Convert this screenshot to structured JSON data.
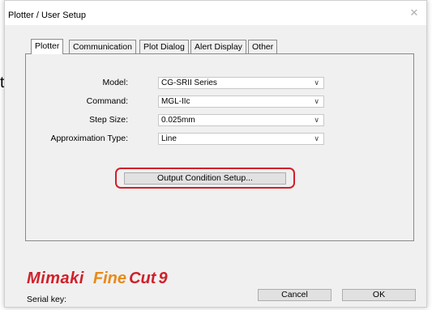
{
  "background": {
    "fragment_text": "t"
  },
  "window": {
    "title": "Plotter / User Setup",
    "close_glyph": "✕"
  },
  "tabs": [
    {
      "label": "Plotter",
      "active": true
    },
    {
      "label": "Communication",
      "active": false
    },
    {
      "label": "Plot Dialog",
      "active": false
    },
    {
      "label": "Alert Display",
      "active": false
    },
    {
      "label": "Other",
      "active": false
    }
  ],
  "fields": {
    "model": {
      "label": "Model:",
      "value": "CG-SRII Series"
    },
    "command": {
      "label": "Command:",
      "value": "MGL-IIc"
    },
    "step_size": {
      "label": "Step Size:",
      "value": "0.025mm"
    },
    "approximation_type": {
      "label": "Approximation Type:",
      "value": "Line"
    }
  },
  "output_condition_button": {
    "label": "Output Condition Setup..."
  },
  "footer": {
    "logo": {
      "brand": "Mimaki",
      "product_fine": "Fine",
      "product_cut": "Cut",
      "version": "9"
    },
    "serial_key_label": "Serial key:",
    "cancel_label": "Cancel",
    "ok_label": "OK"
  },
  "colors": {
    "highlight": "#d0202a",
    "logo_red": "#d0202a",
    "logo_orange": "#e88a1a"
  }
}
